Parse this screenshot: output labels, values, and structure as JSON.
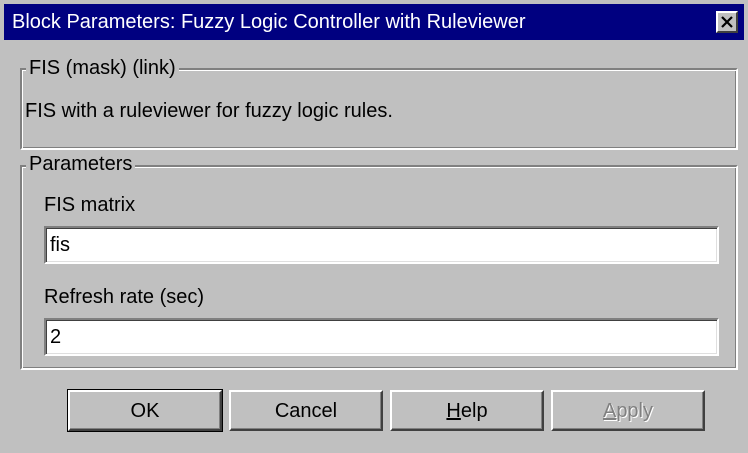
{
  "window": {
    "title": "Block Parameters: Fuzzy Logic  Controller  with Ruleviewer",
    "close_icon": "close-icon"
  },
  "mask_group": {
    "legend": "FIS (mask) (link)",
    "description": "FIS with a ruleviewer for fuzzy logic rules."
  },
  "parameters_group": {
    "legend": "Parameters",
    "fis_matrix": {
      "label": "FIS matrix",
      "value": "fis"
    },
    "refresh_rate": {
      "label": "Refresh rate (sec)",
      "value": "2"
    }
  },
  "buttons": {
    "ok": "OK",
    "cancel": "Cancel",
    "help_mnemonic": "H",
    "help_rest": "elp",
    "apply_mnemonic": "A",
    "apply_rest": "pply",
    "apply_enabled": false
  },
  "colors": {
    "titlebar": "#000080",
    "face": "#c0c0c0",
    "disabled_text": "#808080"
  }
}
